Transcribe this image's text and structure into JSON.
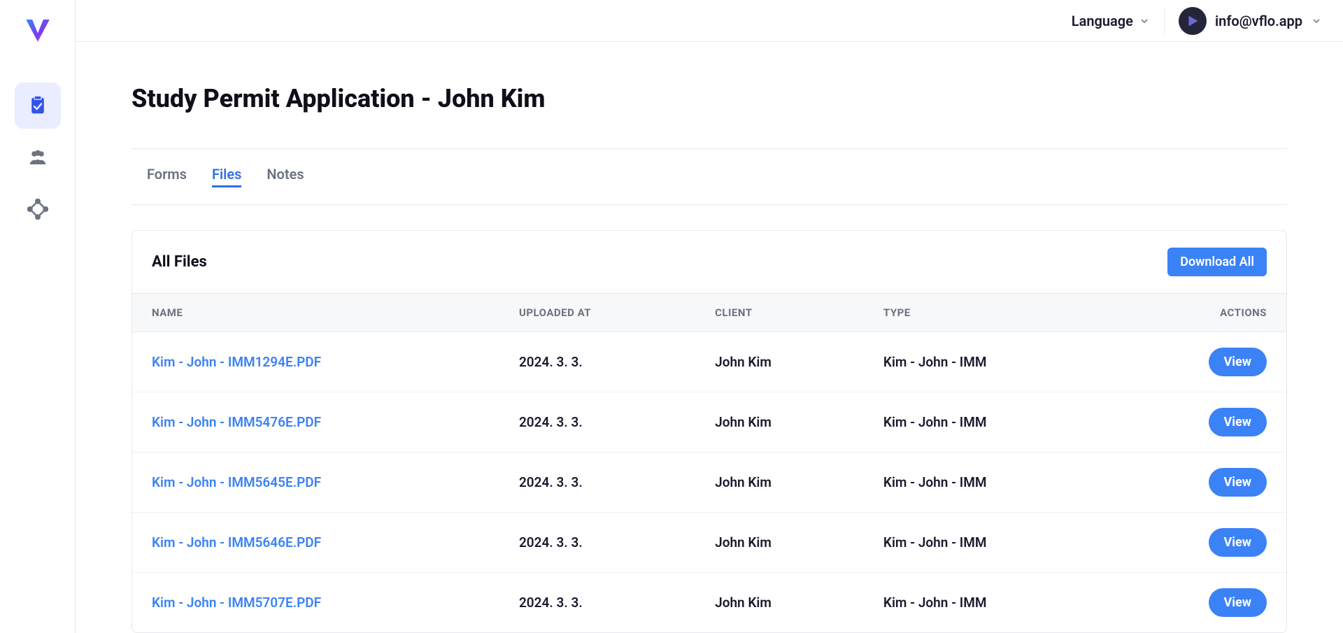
{
  "header": {
    "language_label": "Language",
    "user_email": "info@vflo.app"
  },
  "sidebar": {
    "items": [
      {
        "name": "applications",
        "active": true
      },
      {
        "name": "people",
        "active": false
      },
      {
        "name": "connections",
        "active": false
      }
    ]
  },
  "page": {
    "title": "Study Permit Application - John Kim"
  },
  "tabs": [
    {
      "key": "forms",
      "label": "Forms",
      "active": false
    },
    {
      "key": "files",
      "label": "Files",
      "active": true
    },
    {
      "key": "notes",
      "label": "Notes",
      "active": false
    }
  ],
  "files_panel": {
    "title": "All Files",
    "download_all_label": "Download All",
    "columns": {
      "name": "NAME",
      "uploaded_at": "UPLOADED AT",
      "client": "CLIENT",
      "type": "TYPE",
      "actions": "ACTIONS"
    },
    "view_label": "View",
    "rows": [
      {
        "name": "Kim - John - IMM1294E.PDF",
        "uploaded_at": "2024. 3. 3.",
        "client": "John Kim",
        "type": "Kim - John - IMM"
      },
      {
        "name": "Kim - John - IMM5476E.PDF",
        "uploaded_at": "2024. 3. 3.",
        "client": "John Kim",
        "type": "Kim - John - IMM"
      },
      {
        "name": "Kim - John - IMM5645E.PDF",
        "uploaded_at": "2024. 3. 3.",
        "client": "John Kim",
        "type": "Kim - John - IMM"
      },
      {
        "name": "Kim - John - IMM5646E.PDF",
        "uploaded_at": "2024. 3. 3.",
        "client": "John Kim",
        "type": "Kim - John - IMM"
      },
      {
        "name": "Kim - John - IMM5707E.PDF",
        "uploaded_at": "2024. 3. 3.",
        "client": "John Kim",
        "type": "Kim - John - IMM"
      }
    ]
  }
}
